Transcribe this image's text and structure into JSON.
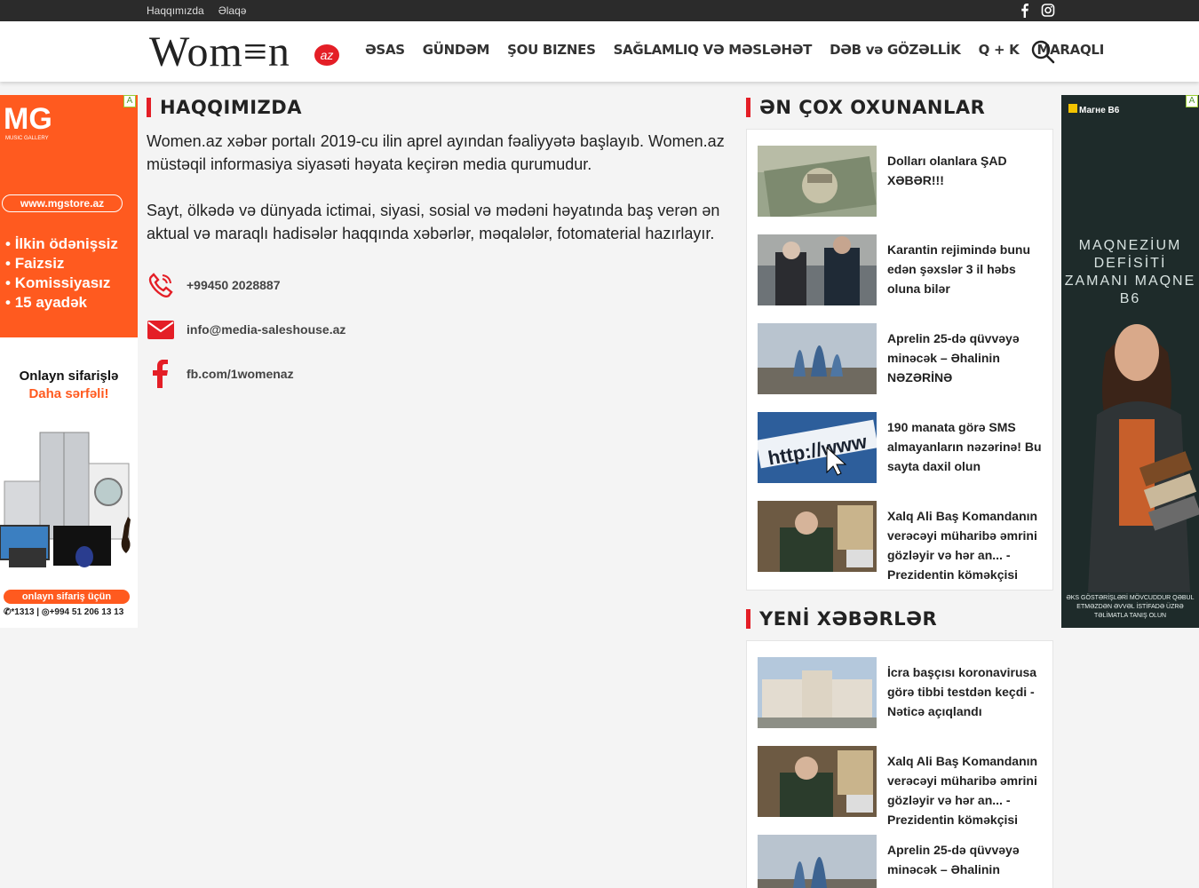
{
  "topbar": {
    "links": [
      "Haqqımızda",
      "Əlaqə"
    ],
    "social_icons": [
      "facebook-icon",
      "instagram-icon"
    ]
  },
  "logo": {
    "word": "Wom≡n",
    "suffix": "az"
  },
  "nav": {
    "items": [
      "ƏSAS",
      "GÜNDƏM",
      "ŞOU BIZNES",
      "SAĞLAMLIQ VƏ MƏSLƏHƏT",
      "DƏB və GÖZƏLLİK",
      "Q + K",
      "MARAQLI"
    ]
  },
  "about": {
    "title": "HAQQIMIZDA",
    "paragraphs": [
      "Women.az xəbər portalı 2019-cu ilin aprel ayından fəaliyyətə başlayıb. Women.az müstəqil informasiya siyasəti həyata keçirən media qurumudur.",
      "Sayt, ölkədə və dünyada ictimai, siyasi, sosial və mədəni həyatında baş verən ən aktual və maraqlı hadisələr haqqında xəbərlər, məqalələr, fotomaterial hazırlayır."
    ],
    "contacts": [
      {
        "icon": "phone-icon",
        "value": "+99450 2028887"
      },
      {
        "icon": "mail-icon",
        "value": "info@media-saleshouse.az"
      },
      {
        "icon": "facebook-icon",
        "value": "fb.com/1womenaz"
      }
    ]
  },
  "popular": {
    "title": "ƏN ÇOX OXUNANLAR",
    "items": [
      {
        "title": "Dolları olanlara ŞAD XƏBƏR!!!"
      },
      {
        "title": "Karantin rejimində bunu edən şəxslər 3 il həbs oluna bilər"
      },
      {
        "title": "Aprelin 25-də qüvvəyə minəcək – Əhalinin NƏZƏRİNƏ"
      },
      {
        "title": "190 manata görə SMS almayanların nəzərinə! Bu sayta daxil olun"
      },
      {
        "title": "Xalq Ali Baş Komandanın verəcəyi müharibə əmrini gözləyir və hər an... - Prezidentin köməkçisi"
      }
    ]
  },
  "latest": {
    "title": "YENİ XƏBƏRLƏR",
    "items": [
      {
        "title": "İcra başçısı koronavirusa görə tibbi testdən keçdi - Nəticə açıqlandı"
      },
      {
        "title": "Xalq Ali Baş Komandanın verəcəyi müharibə əmrini gözləyir və hər an... - Prezidentin köməkçisi"
      },
      {
        "title": "Aprelin 25-də qüvvəyə minəcək – Əhalinin"
      }
    ]
  },
  "ad_left": {
    "brand": "MG",
    "brand_sub": "MUSIC GALLERY",
    "url": "www.mgstore.az",
    "bullets": [
      "İlkin ödənişsiz",
      "Faizsiz",
      "Komissiyasız",
      "15 ayadək"
    ],
    "online_line1": "Onlayn sifarişlə",
    "online_line2": "Daha sərfəli!",
    "order_button": "onlayn sifariş üçün",
    "phones": "✆*1313 | ◎+994 51 206 13 13",
    "badge": "A"
  },
  "ad_right": {
    "brand": "Магне В6",
    "headline": "MAQNEZİUM DEFİSİTİ ZAMANI MAQNE B6",
    "disclaimer": "ƏKS GÖSTƏRİŞLƏRİ MÖVCUDDUR QƏBUL ETMƏZDƏN ƏVVƏL İSTİFADƏ ÜZRƏ TƏLİMATLA TANIŞ OLUN",
    "badge": "A"
  },
  "colors": {
    "accent": "#e41e26",
    "topbar": "#2b2b2b",
    "ad_orange": "#ff5a1f"
  }
}
